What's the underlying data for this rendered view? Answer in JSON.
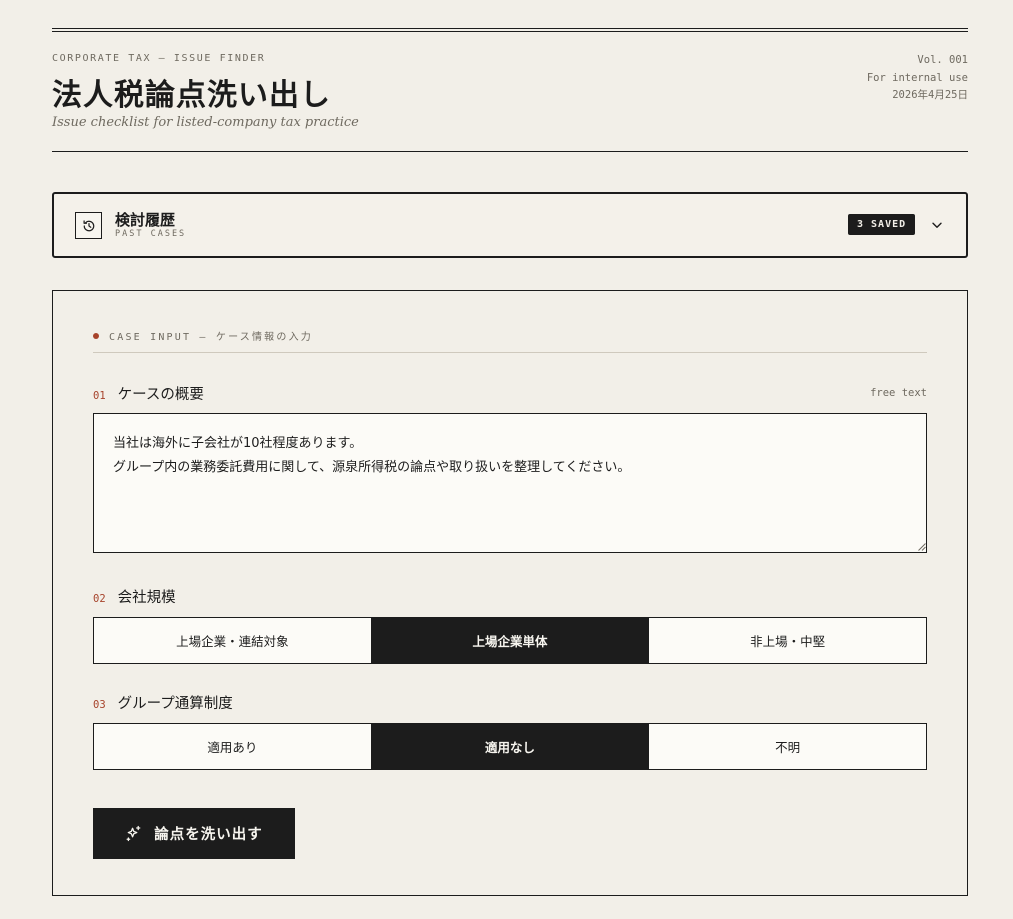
{
  "header": {
    "eyebrow": "CORPORATE TAX — ISSUE FINDER",
    "title": "法人税論点洗い出し",
    "subtitle": "Issue checklist for listed-company tax practice",
    "volume": "Vol. 001",
    "audience": "For internal use",
    "date": "2026年4月25日"
  },
  "history": {
    "icon": "history-icon",
    "title": "検討履歴",
    "subtitle": "PAST CASES",
    "badge": "3 SAVED",
    "toggle_icon": "chevron-down-icon"
  },
  "case_input": {
    "section_label": "CASE INPUT — ケース情報の入力",
    "summary": {
      "number": "01",
      "label": "ケースの概要",
      "hint": "free text",
      "value": "当社は海外に子会社が10社程度あります。\nグループ内の業務委託費用に関して、源泉所得税の論点や取り扱いを整理してください。"
    },
    "company_size": {
      "number": "02",
      "label": "会社規模",
      "options": [
        "上場企業・連結対象",
        "上場企業単体",
        "非上場・中堅"
      ],
      "selected": "上場企業単体"
    },
    "group_tax": {
      "number": "03",
      "label": "グループ通算制度",
      "options": [
        "適用あり",
        "適用なし",
        "不明"
      ],
      "selected": "適用なし"
    },
    "submit": {
      "icon": "sparkle-icon",
      "label": "論点を洗い出す"
    }
  },
  "colors": {
    "background": "#f2efe8",
    "ink": "#1c1c1c",
    "accent": "#a7432b",
    "muted": "#6f6a60"
  }
}
